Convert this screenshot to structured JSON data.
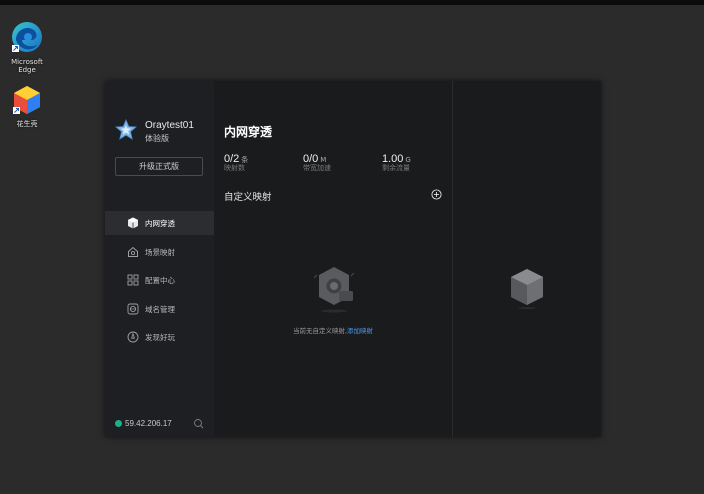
{
  "desktop": {
    "icons": [
      {
        "name": "Microsoft Edge",
        "label_line1": "Microsoft",
        "label_line2": "Edge"
      },
      {
        "name": "花生壳",
        "label_line1": "花生壳"
      }
    ]
  },
  "titlebar": {
    "buttons": [
      "qr-icon",
      "menu-icon",
      "minimize-icon",
      "close-icon"
    ]
  },
  "sidebar": {
    "username": "Oraytest01",
    "account_type": "体验版",
    "upgrade_label": "升级正式版",
    "items": [
      {
        "label": "内网穿透",
        "icon": "cube-icon",
        "active": true
      },
      {
        "label": "场景映射",
        "icon": "scene-icon",
        "active": false
      },
      {
        "label": "配置中心",
        "icon": "grid-icon",
        "active": false
      },
      {
        "label": "域名管理",
        "icon": "domain-icon",
        "active": false
      },
      {
        "label": "发现好玩",
        "icon": "compass-icon",
        "active": false
      }
    ],
    "ip": "59.42.206.17"
  },
  "main": {
    "title": "内网穿透",
    "stats": [
      {
        "value": "0/2",
        "unit": "条",
        "label": "映射数"
      },
      {
        "value": "0/0",
        "unit": "M",
        "label": "带宽加速"
      },
      {
        "value": "1.00",
        "unit": "G",
        "label": "剩余流量"
      }
    ],
    "section_title": "自定义映射",
    "empty_text": "当前无自定义映射,",
    "empty_link": "添加映射"
  },
  "colors": {
    "accent": "#4a9af5",
    "active_bg": "#2c2d31",
    "status_dot": "#1db08a"
  }
}
